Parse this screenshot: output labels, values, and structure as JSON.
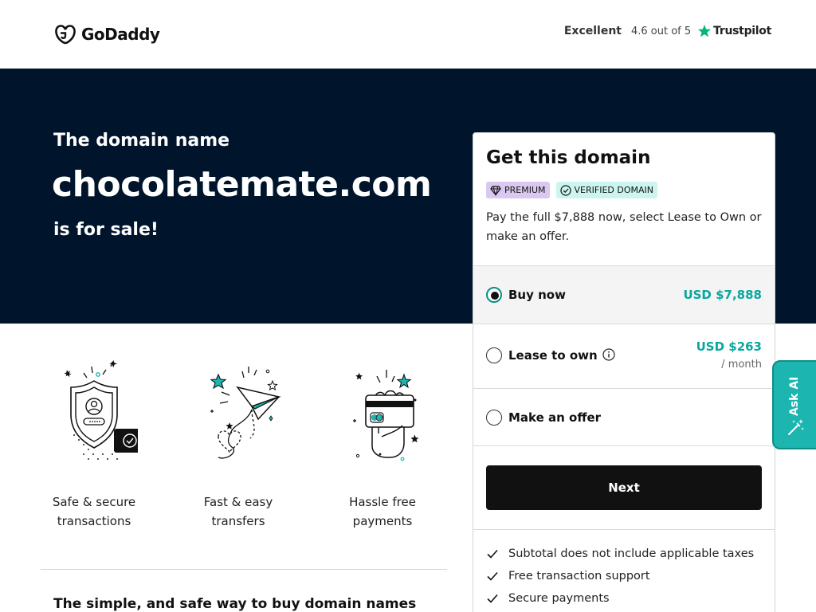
{
  "header": {
    "logo_text": "GoDaddy",
    "trust_excellent": "Excellent",
    "trust_rating": "4.6 out of 5",
    "trust_brand": "Trustpilot"
  },
  "hero": {
    "pre": "The domain name",
    "domain": "chocolatemate.com",
    "post": "is for sale!"
  },
  "features": [
    {
      "line1": "Safe & secure",
      "line2": "transactions",
      "icon": "shield-icon"
    },
    {
      "line1": "Fast & easy",
      "line2": "transfers",
      "icon": "paper-plane-icon"
    },
    {
      "line1": "Hassle free",
      "line2": "payments",
      "icon": "payment-card-icon"
    }
  ],
  "bottom_heading": "The simple, and safe way to buy domain names",
  "card": {
    "title": "Get this domain",
    "badges": {
      "premium": "PREMIUM",
      "verified": "VERIFIED DOMAIN"
    },
    "description": "Pay the full $7,888 now, select Lease to Own or make an offer.",
    "options": {
      "buy_now": {
        "label": "Buy now",
        "price": "USD $7,888",
        "selected": true
      },
      "lease": {
        "label": "Lease to own",
        "price": "USD $263",
        "sub": "/ month",
        "selected": false
      },
      "offer": {
        "label": "Make an offer",
        "selected": false
      }
    },
    "next_label": "Next",
    "checks": [
      "Subtotal does not include applicable taxes",
      "Free transaction support",
      "Secure payments"
    ]
  },
  "ask_ai": {
    "label": "Ask AI"
  },
  "colors": {
    "hero_bg": "#00142c",
    "accent_teal": "#09a6a0",
    "ask_ai_bg": "#1cb5b0",
    "premium_badge": "#d9c8ef",
    "verified_badge": "#cdf5ef",
    "button_bg": "#111111"
  }
}
